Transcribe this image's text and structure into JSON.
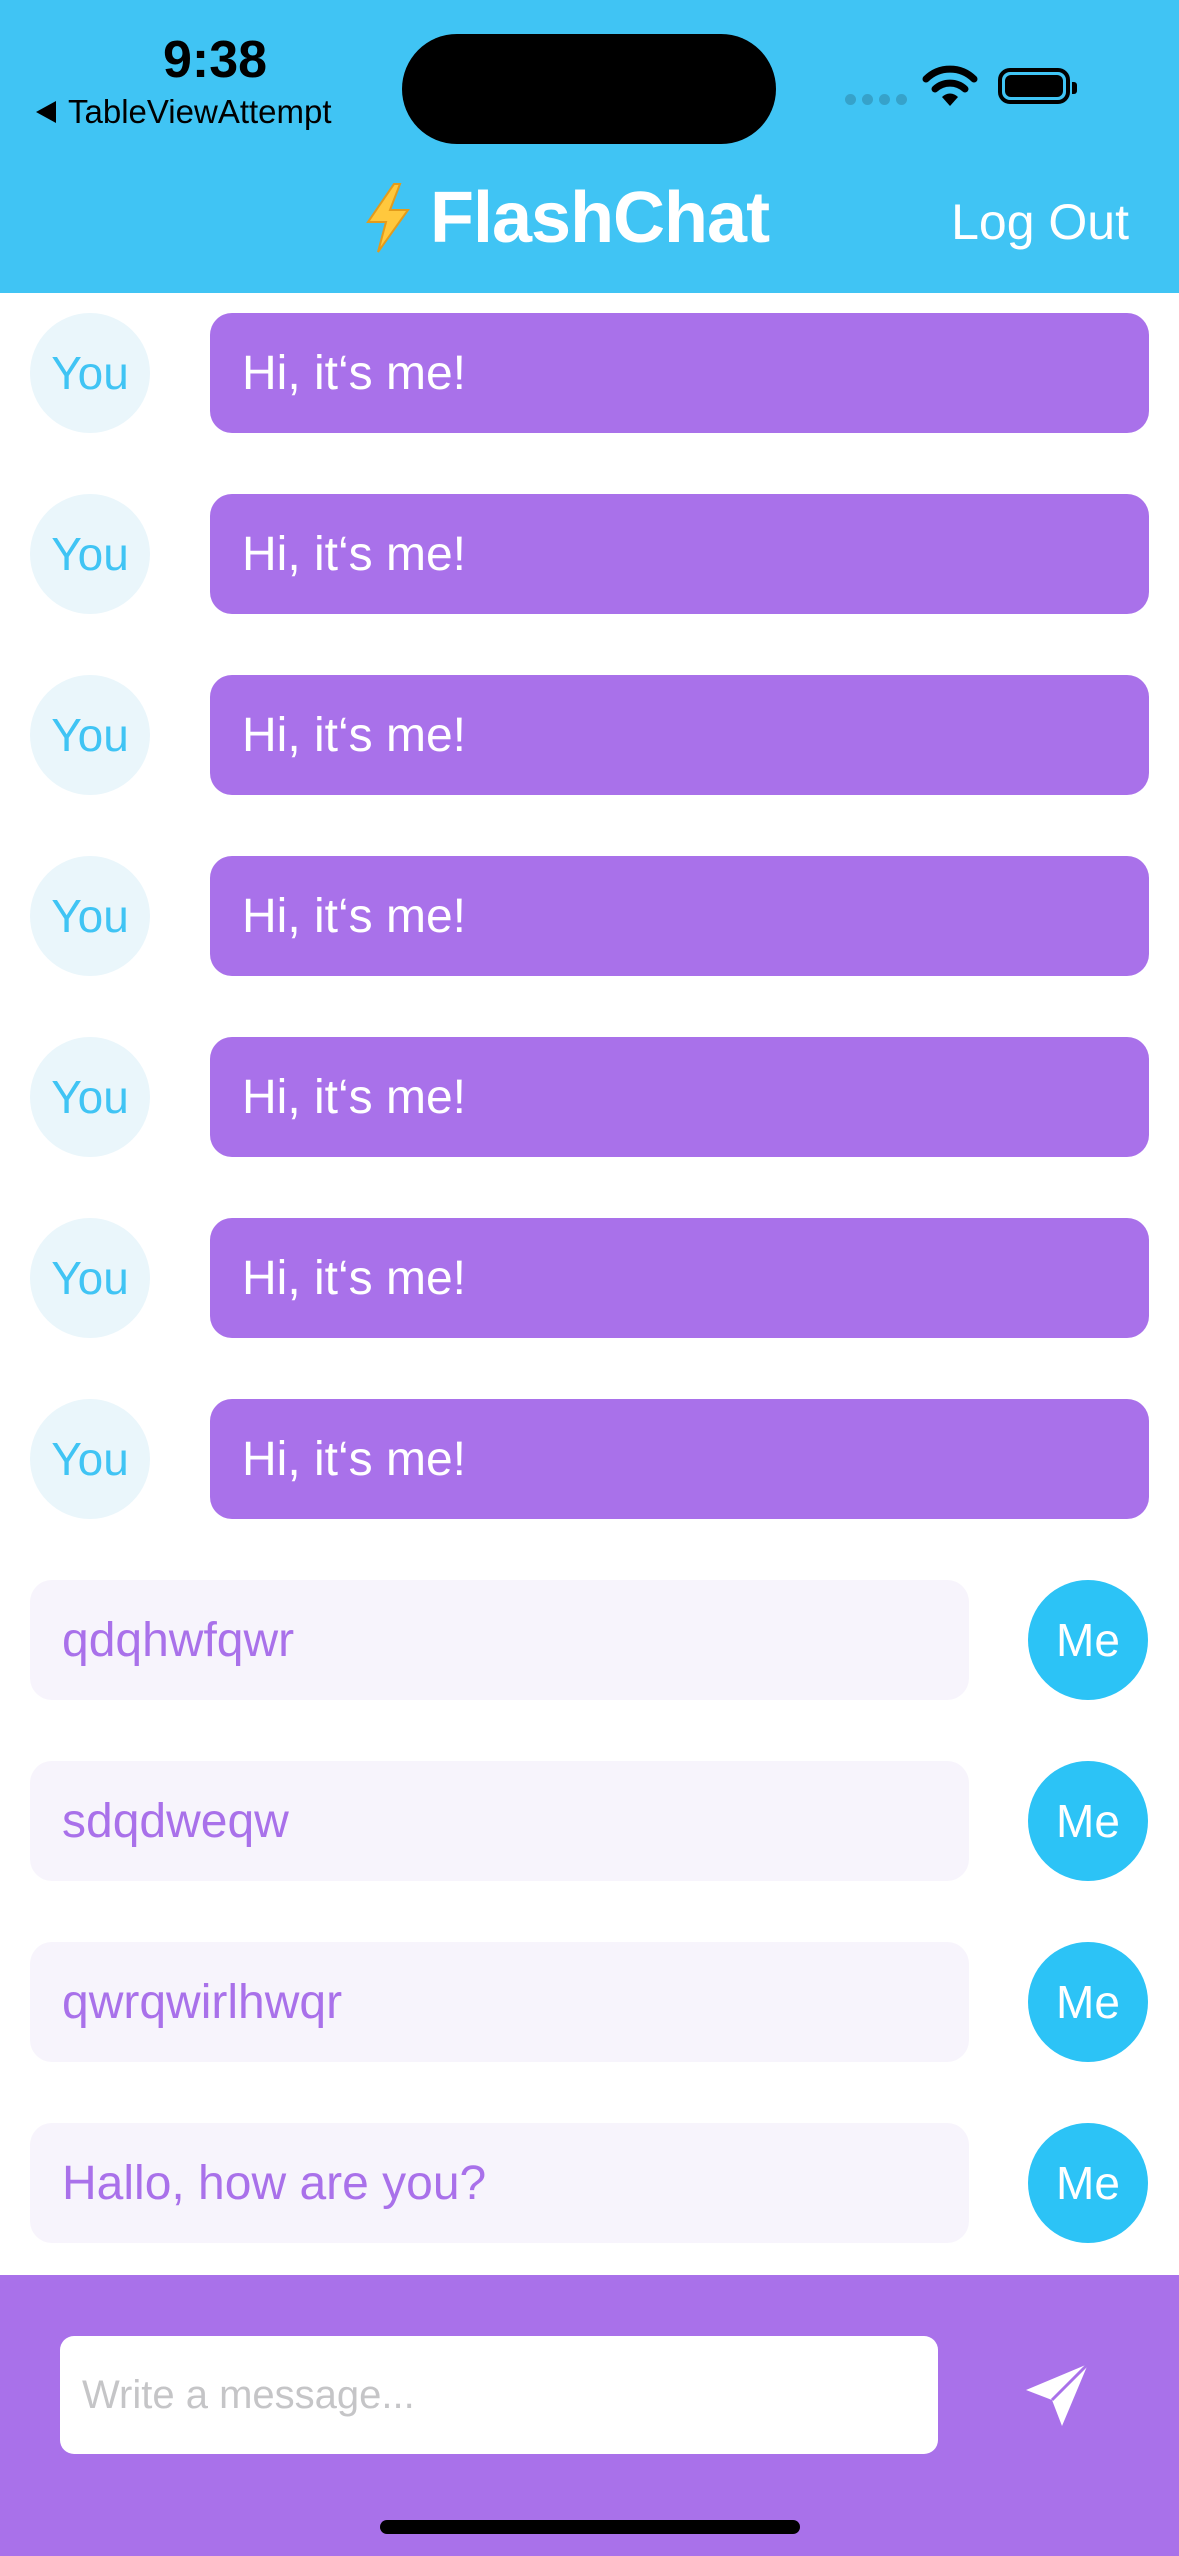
{
  "status_bar": {
    "time": "9:38",
    "back_app": "TableViewAttempt"
  },
  "nav": {
    "emoji": "⚡",
    "title": "FlashChat",
    "logout_label": "Log Out"
  },
  "messages": [
    {
      "sender": "You",
      "text": "Hi, it‘s me!"
    },
    {
      "sender": "You",
      "text": "Hi, it‘s me!"
    },
    {
      "sender": "You",
      "text": "Hi, it‘s me!"
    },
    {
      "sender": "You",
      "text": "Hi, it‘s me!"
    },
    {
      "sender": "You",
      "text": "Hi, it‘s me!"
    },
    {
      "sender": "You",
      "text": "Hi, it‘s me!"
    },
    {
      "sender": "You",
      "text": "Hi, it‘s me!"
    },
    {
      "sender": "Me",
      "text": "qdqhwfqwr"
    },
    {
      "sender": "Me",
      "text": "sdqdweqw"
    },
    {
      "sender": "Me",
      "text": "qwrqwirlhwqr"
    },
    {
      "sender": "Me",
      "text": "Hallo, how are you?"
    }
  ],
  "composer": {
    "placeholder": "Write a message...",
    "value": ""
  },
  "colors": {
    "header": "#40C4F4",
    "purple": "#A971EA",
    "me_avatar": "#2CC3F6",
    "you_avatar_bg": "#EAF6FB",
    "outgoing_bubble": "#F7F4FC"
  },
  "icons": {
    "send": "paperplane-icon",
    "bolt": "lightning-bolt-icon",
    "back": "back-triangle-icon"
  }
}
